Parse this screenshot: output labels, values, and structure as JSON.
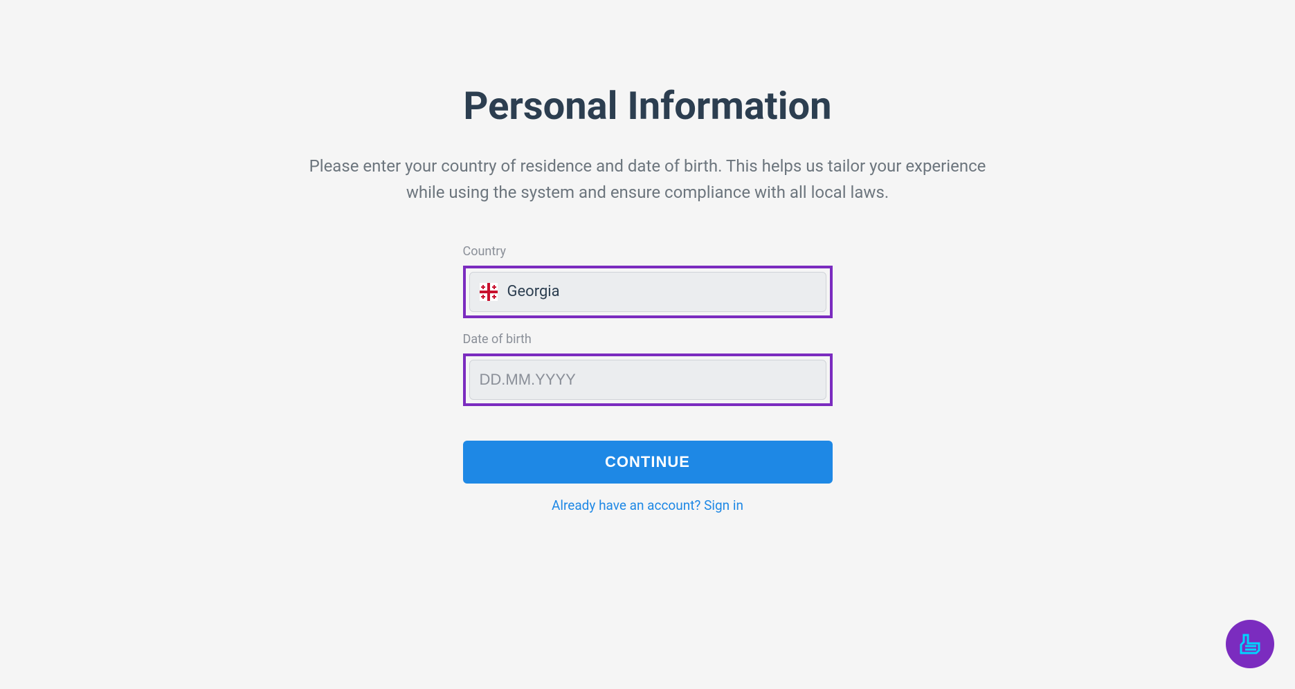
{
  "header": {
    "title": "Personal Information",
    "description": "Please enter your country of residence and date of birth. This helps us tailor your experience while using the system and ensure compliance with all local laws."
  },
  "form": {
    "country": {
      "label": "Country",
      "value": "Georgia"
    },
    "dob": {
      "label": "Date of birth",
      "placeholder": "DD.MM.YYYY",
      "value": ""
    }
  },
  "actions": {
    "continue_label": "CONTINUE",
    "sign_in_text": "Already have an account? Sign in"
  }
}
